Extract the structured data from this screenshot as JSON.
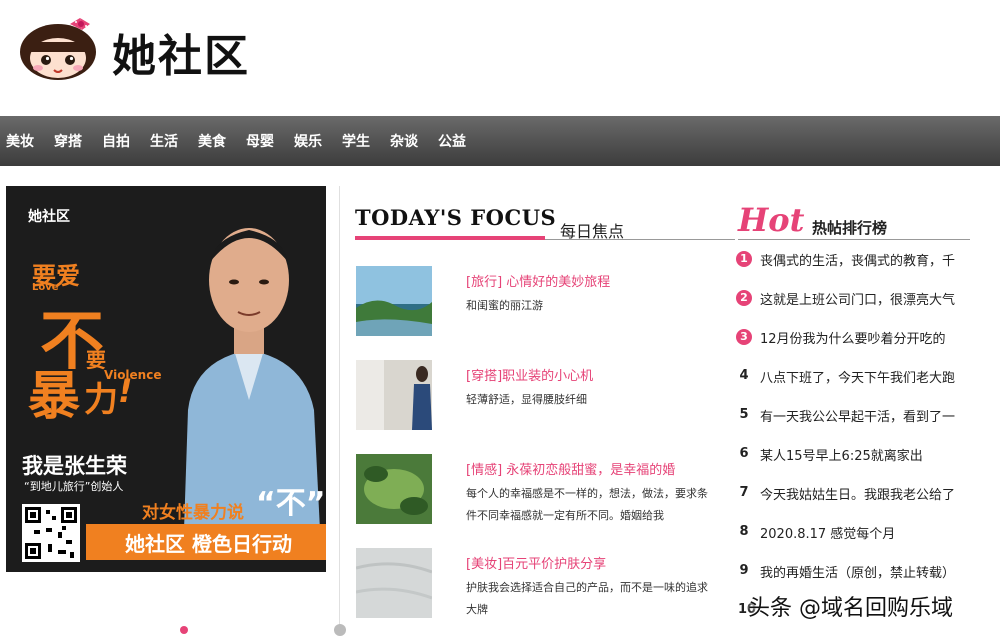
{
  "header": {
    "site_name": "她社区"
  },
  "nav": {
    "items": [
      "美妆",
      "穿搭",
      "自拍",
      "生活",
      "美食",
      "母婴",
      "娱乐",
      "学生",
      "杂谈",
      "公益"
    ]
  },
  "poster": {
    "logo": "她社区",
    "line1": "要爱",
    "line1b": "Love",
    "big1": "不",
    "big2": "要",
    "big3": "暴",
    "big4": "力",
    "excl": "!",
    "violence": "Violence",
    "name": "我是张生荣",
    "role": "“到地儿旅行”创始人",
    "slogan": "对女性暴力说",
    "bu": "“不”",
    "bar": "她社区 橙色日行动"
  },
  "focus": {
    "title": "TODAY'S FOCUS",
    "subtitle": "每日焦点",
    "articles": [
      {
        "title": "[旅行] 心情好的美妙旅程",
        "desc": "和闺蜜的丽江游"
      },
      {
        "title": "[穿搭]职业装的小心机",
        "desc": "轻薄舒适，显得腰肢纤细"
      },
      {
        "title": "[情感] 永葆初恋般甜蜜，是幸福的婚",
        "desc": "每个人的幸福感是不一样的，想法，做法，要求条件不同幸福感就一定有所不同。婚姻给我"
      },
      {
        "title": "[美妆]百元平价护肤分享",
        "desc": "护肤我会选择适合自己的产品，而不是一味的追求大牌"
      }
    ]
  },
  "hot": {
    "logo": "Hot",
    "title": "热帖排行榜",
    "items": [
      {
        "num": "1",
        "text": "丧偶式的生活，丧偶式的教育，千"
      },
      {
        "num": "2",
        "text": "这就是上班公司门口，很漂亮大气"
      },
      {
        "num": "3",
        "text": "12月份我为什么要吵着分开吃的"
      },
      {
        "num": "4",
        "text": "八点下班了，今天下午我们老大跑"
      },
      {
        "num": "5",
        "text": "有一天我公公早起干活，看到了一"
      },
      {
        "num": "6",
        "text": "某人15号早上6:25就离家出"
      },
      {
        "num": "7",
        "text": "今天我姑姑生日。我跟我老公给了"
      },
      {
        "num": "8",
        "text": "2020.8.17 感觉每个月"
      },
      {
        "num": "9",
        "text": "我的再婚生活（原创，禁止转载）"
      },
      {
        "num": "10",
        "text": ""
      }
    ]
  },
  "watermark": "头条 @域名回购乐域",
  "colors": {
    "accent": "#e64377",
    "nav_bg": "#4a4a4a",
    "poster_orange": "#f08020"
  }
}
